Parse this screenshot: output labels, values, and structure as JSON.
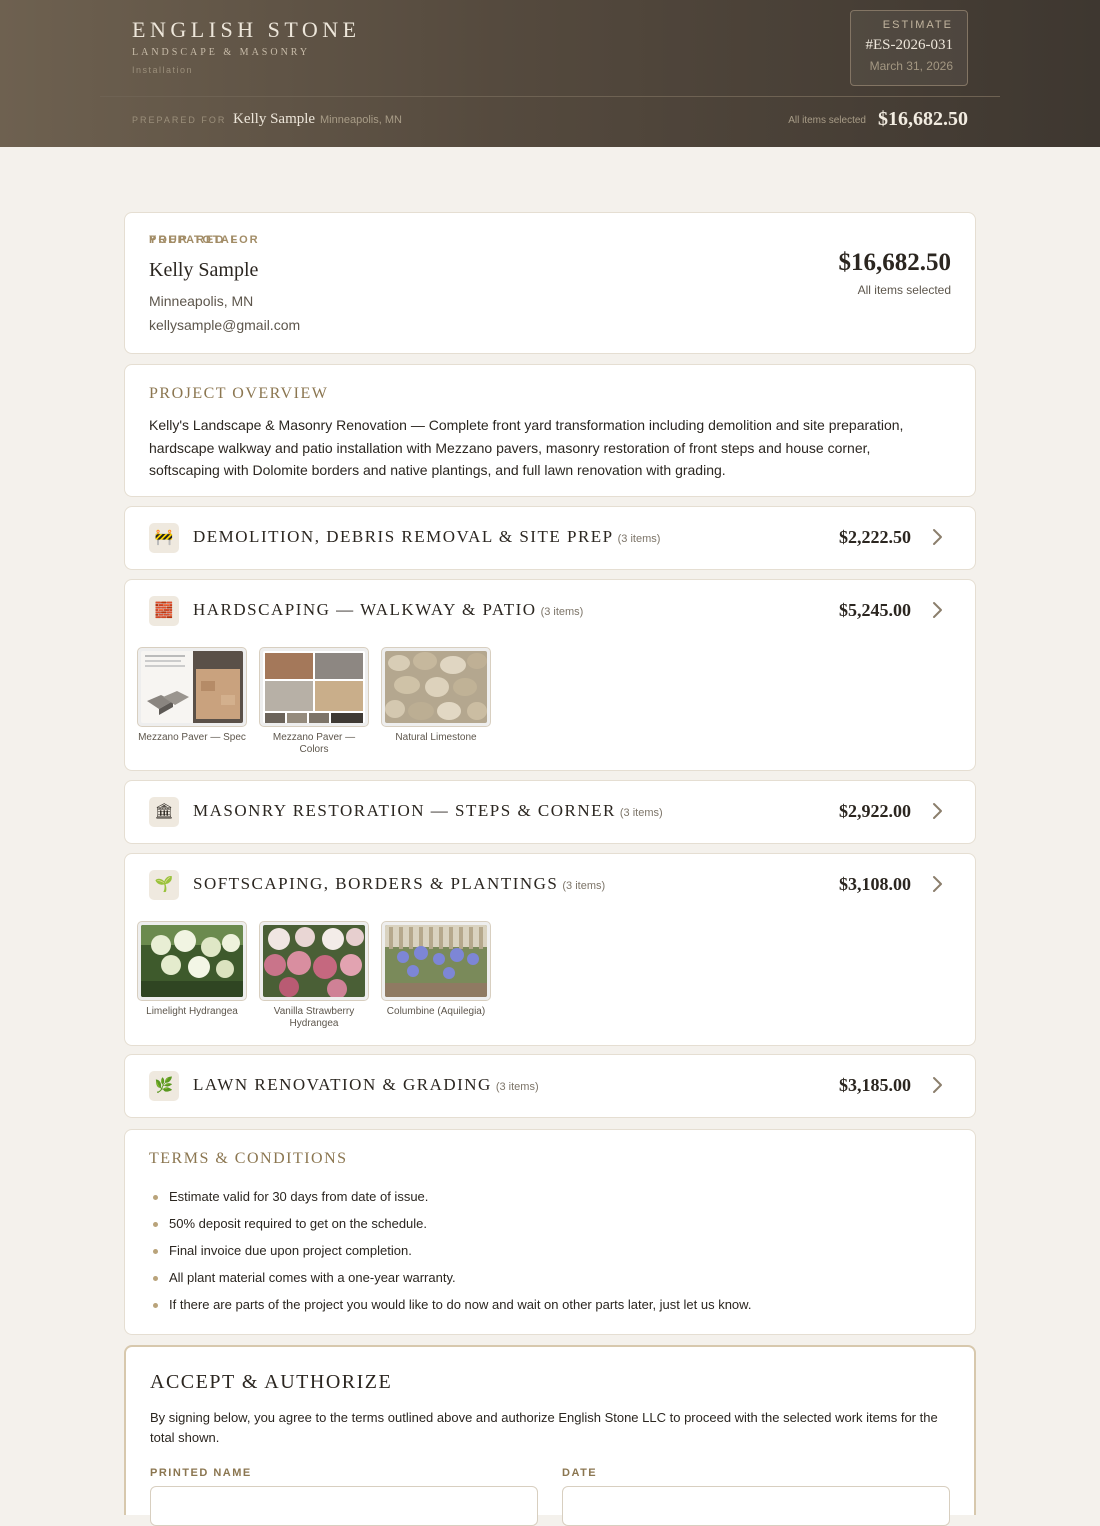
{
  "header": {
    "brand_name": "ENGLISH STONE",
    "brand_subtitle": "LANDSCAPE & MASONRY",
    "brand_tag": "Installation",
    "estimate_label": "ESTIMATE",
    "estimate_number": "#ES-2026-031",
    "estimate_date": "March 31, 2026",
    "prepared_for_label": "PREPARED FOR",
    "client_name": "Kelly Sample",
    "client_location": "Minneapolis, MN",
    "selection_status": "All items selected",
    "total": "$16,682.50"
  },
  "client_card": {
    "eyebrow": "PREPARED FOR",
    "name": "Kelly Sample",
    "location": "Minneapolis, MN",
    "email": "kellysample@gmail.com",
    "total_eyebrow": "YOUR TOTAL",
    "total": "$16,682.50",
    "selection_status": "All items selected"
  },
  "overview": {
    "title": "PROJECT OVERVIEW",
    "text": "Kelly's Landscape & Masonry Renovation — Complete front yard transformation including demolition and site preparation, hardscape walkway and patio installation with Mezzano pavers, masonry restoration of front steps and house corner, softscaping with Dolomite borders and native plantings, and full lawn renovation with grading."
  },
  "categories": [
    {
      "icon": "construction-barrier-icon",
      "glyph": "🚧",
      "title": "DEMOLITION, DEBRIS REMOVAL & SITE PREP",
      "count": "(3 items)",
      "price": "$2,222.50"
    },
    {
      "icon": "bricks-icon",
      "glyph": "🧱",
      "title": "HARDSCAPING — WALKWAY & PATIO",
      "count": "(3 items)",
      "price": "$5,245.00",
      "images": [
        {
          "caption": "Mezzano Paver — Spec"
        },
        {
          "caption": "Mezzano Paver — Colors"
        },
        {
          "caption": "Natural Limestone"
        }
      ]
    },
    {
      "icon": "classical-building-icon",
      "glyph": "🏛",
      "title": "MASONRY RESTORATION — STEPS & CORNER",
      "count": "(3 items)",
      "price": "$2,922.00"
    },
    {
      "icon": "seedling-icon",
      "glyph": "🌱",
      "title": "SOFTSCAPING, BORDERS & PLANTINGS",
      "count": "(3 items)",
      "price": "$3,108.00",
      "images": [
        {
          "caption": "Limelight Hydrangea"
        },
        {
          "caption": "Vanilla Strawberry Hydrangea"
        },
        {
          "caption": "Columbine (Aquilegia)"
        }
      ]
    },
    {
      "icon": "herb-icon",
      "glyph": "🌿",
      "title": "LAWN RENOVATION & GRADING",
      "count": "(3 items)",
      "price": "$3,185.00"
    }
  ],
  "terms": {
    "title": "TERMS & CONDITIONS",
    "items": [
      "Estimate valid for 30 days from date of issue.",
      "50% deposit required to get on the schedule.",
      "Final invoice due upon project completion.",
      "All plant material comes with a one-year warranty.",
      "If there are parts of the project you would like to do now and wait on other parts later, just let us know."
    ]
  },
  "accept": {
    "title": "ACCEPT & AUTHORIZE",
    "text": "By signing below, you agree to the terms outlined above and authorize English Stone LLC to proceed with the selected work items for the total shown.",
    "printed_name_label": "PRINTED NAME",
    "date_label": "DATE"
  },
  "colors": {
    "header_start": "#6e6150",
    "header_end": "#3e3730",
    "accent_gold": "#a28c66",
    "page_bg": "#f4f1ec"
  }
}
